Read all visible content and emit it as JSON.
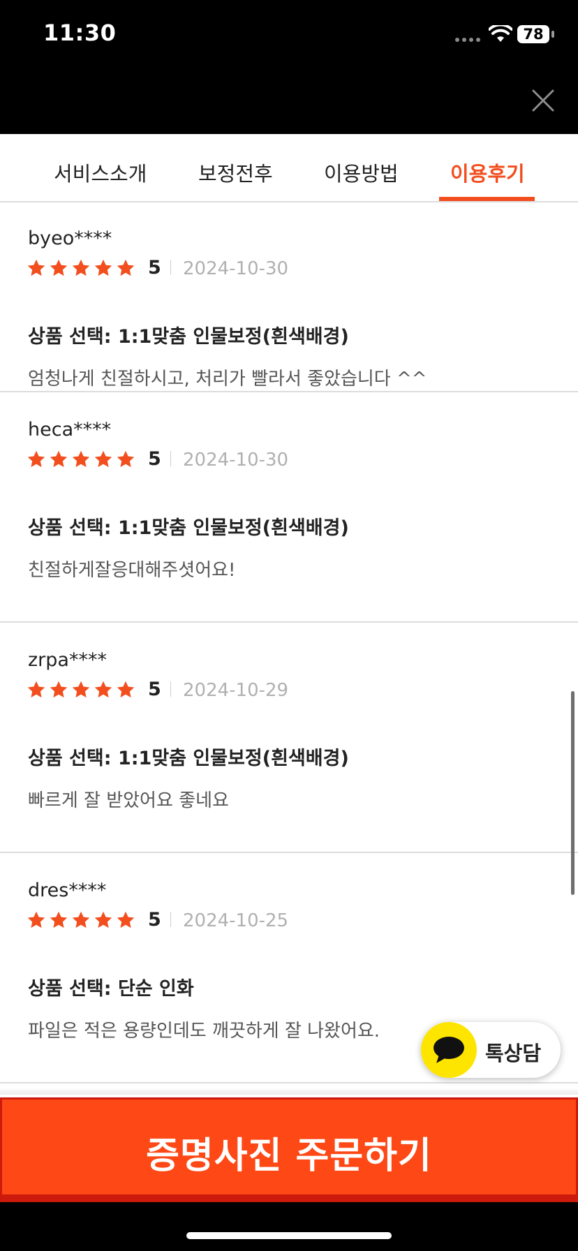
{
  "status_bar": {
    "time": "11:30",
    "battery": "78"
  },
  "tabs": [
    {
      "label": "서비스소개"
    },
    {
      "label": "보정전후"
    },
    {
      "label": "이용방법"
    },
    {
      "label": "이용후기",
      "active": true
    }
  ],
  "reviews": [
    {
      "user": "byeo****",
      "rating": 5,
      "score": "5",
      "date": "2024-10-30",
      "product": "상품 선택: 1:1맞춤 인물보정(흰색배경)",
      "content": "엄청나게 친절하시고, 처리가 빨라서 좋았습니다 ^^"
    },
    {
      "user": "heca****",
      "rating": 5,
      "score": "5",
      "date": "2024-10-30",
      "product": "상품 선택: 1:1맞춤 인물보정(흰색배경)",
      "content": "친절하게잘응대해주셧어요!"
    },
    {
      "user": "zrpa****",
      "rating": 5,
      "score": "5",
      "date": "2024-10-29",
      "product": "상품 선택: 1:1맞춤 인물보정(흰색배경)",
      "content": "빠르게 잘 받았어요 좋네요"
    },
    {
      "user": "dres****",
      "rating": 5,
      "score": "5",
      "date": "2024-10-25",
      "product": "상품 선택: 단순 인화",
      "content": "파일은 적은 용량인데도 깨끗하게 잘 나왔어요."
    }
  ],
  "kakao": {
    "label": "톡상담"
  },
  "order_button": {
    "label": "증명사진 주문하기"
  },
  "colors": {
    "accent": "#f24e1e",
    "star": "#f24e1e",
    "order_bg": "#fe4816",
    "kakao_yellow": "#fee500"
  }
}
